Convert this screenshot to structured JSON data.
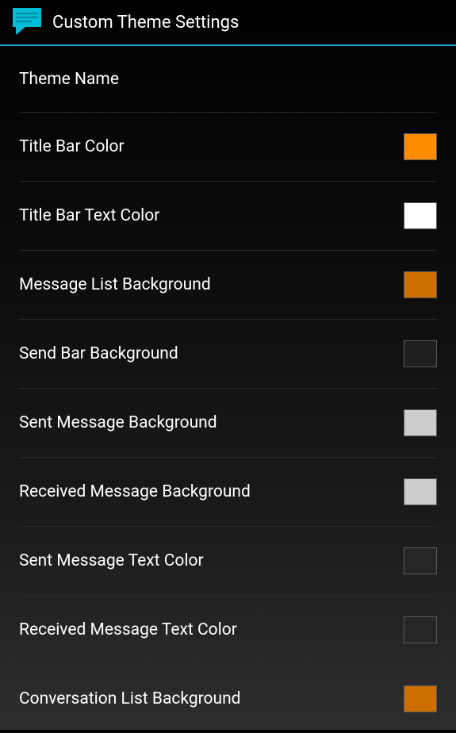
{
  "header": {
    "title": "Custom Theme Settings",
    "icon": "messaging-icon"
  },
  "settings": [
    {
      "label": "Theme Name",
      "color": null
    },
    {
      "label": "Title Bar Color",
      "color": "#ff8c00"
    },
    {
      "label": "Title Bar Text Color",
      "color": "#ffffff"
    },
    {
      "label": "Message List Background",
      "color": "#cc6e00"
    },
    {
      "label": "Send Bar Background",
      "color": "#1f1f1f"
    },
    {
      "label": "Sent Message Background",
      "color": "#cccccc"
    },
    {
      "label": "Received Message Background",
      "color": "#cccccc"
    },
    {
      "label": "Sent Message Text Color",
      "color": "#262626"
    },
    {
      "label": "Received Message Text Color",
      "color": "#262626"
    },
    {
      "label": "Conversation List Background",
      "color": "#cc6e00"
    }
  ]
}
